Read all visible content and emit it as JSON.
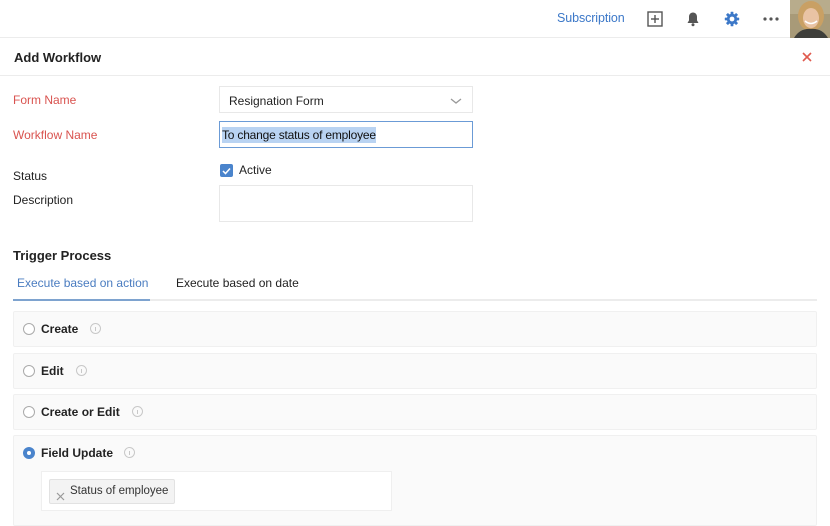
{
  "topbar": {
    "subscription_label": "Subscription",
    "icons": [
      "add-square-icon",
      "bell-icon",
      "gear-icon",
      "more-icon"
    ],
    "accent_color": "#3c78c8"
  },
  "header": {
    "title": "Add Workflow",
    "close_color": "#e05a4e"
  },
  "form": {
    "form_name_label": "Form Name",
    "form_name_value": "Resignation Form",
    "workflow_name_label": "Workflow Name",
    "workflow_name_value": "To change status of employee",
    "status_label": "Status",
    "status_checkbox_label": "Active",
    "status_checked": true,
    "description_label": "Description",
    "description_value": ""
  },
  "trigger": {
    "title": "Trigger Process",
    "tabs": [
      {
        "label": "Execute based on action",
        "active": true
      },
      {
        "label": "Execute based on date",
        "active": false
      }
    ],
    "options": [
      {
        "label": "Create",
        "selected": false
      },
      {
        "label": "Edit",
        "selected": false
      },
      {
        "label": "Create or Edit",
        "selected": false
      },
      {
        "label": "Field Update",
        "selected": true
      }
    ],
    "field_update_tags": [
      "Status of employee"
    ]
  }
}
